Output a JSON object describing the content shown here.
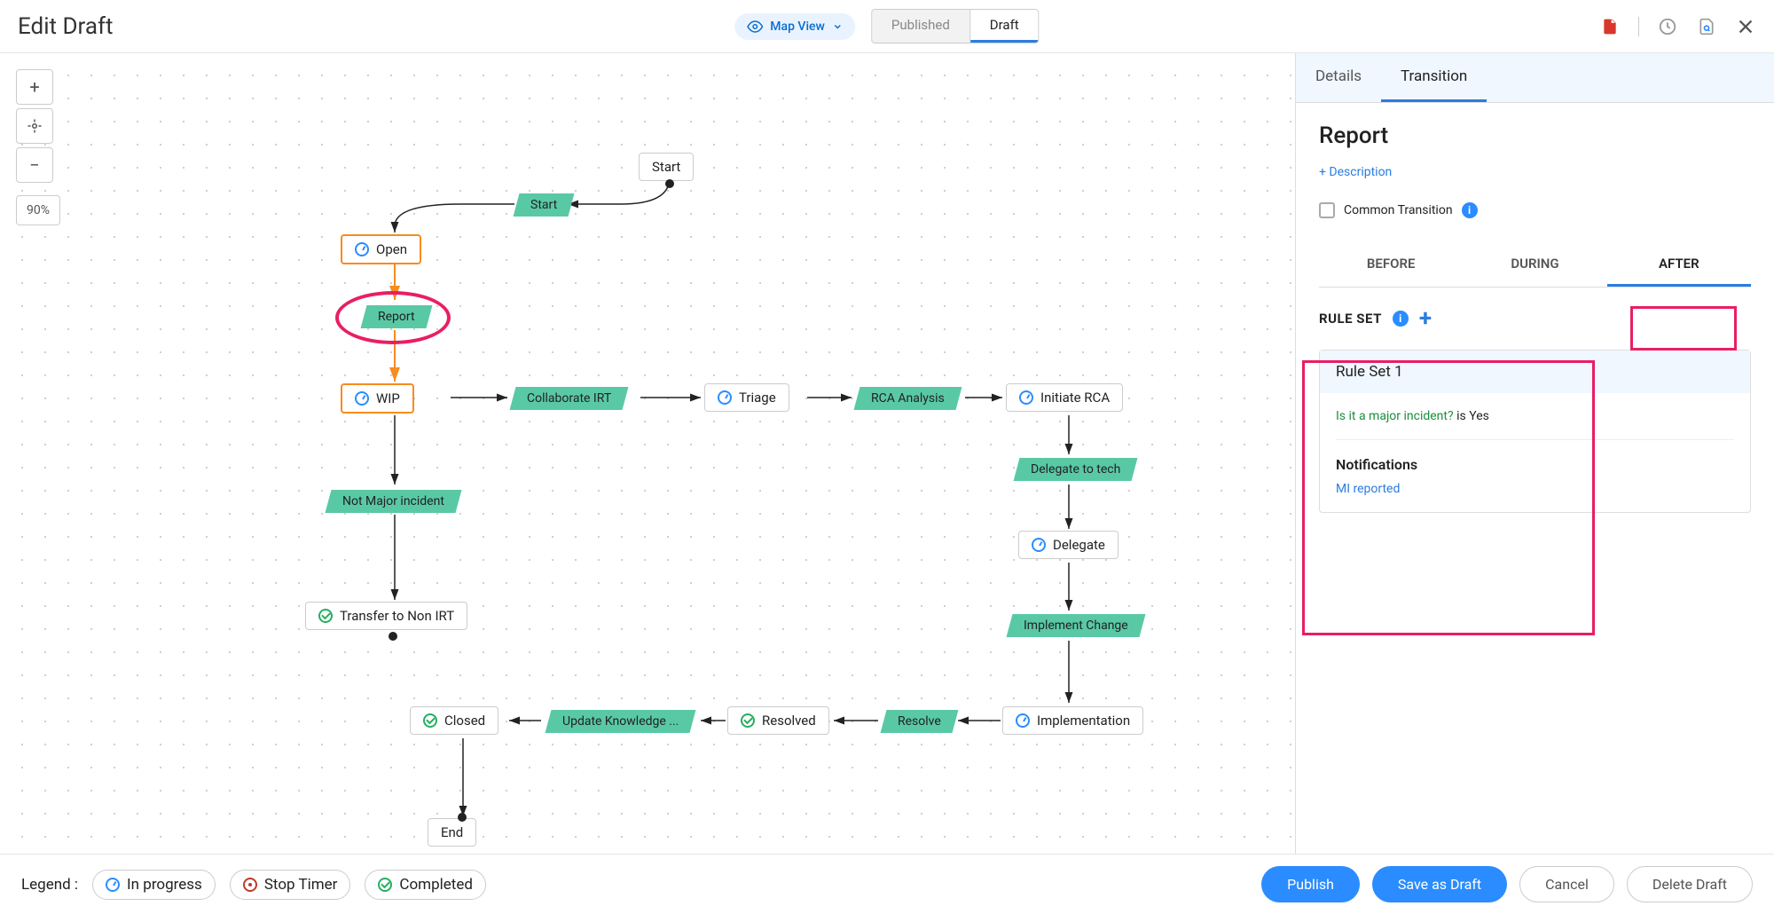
{
  "header": {
    "title": "Edit Draft",
    "map_view": "Map View",
    "seg_published": "Published",
    "seg_draft": "Draft"
  },
  "zoom": {
    "pct": "90%"
  },
  "nodes": {
    "start": "Start",
    "open": "Open",
    "wip": "WIP",
    "triage": "Triage",
    "initiate_rca": "Initiate RCA",
    "delegate": "Delegate",
    "transfer": "Transfer to Non IRT",
    "closed": "Closed",
    "resolved": "Resolved",
    "implementation": "Implementation",
    "end": "End"
  },
  "trans": {
    "start": "Start",
    "report": "Report",
    "collab": "Collaborate IRT",
    "rca": "RCA Analysis",
    "delegate_tech": "Delegate to tech",
    "not_major": "Not Major incident",
    "impl_change": "Implement Change",
    "update_k": "Update Knowledge ...",
    "resolve": "Resolve"
  },
  "panel": {
    "tab_details": "Details",
    "tab_transition": "Transition",
    "title": "Report",
    "add_desc": "+ Description",
    "common": "Common Transition",
    "sub_before": "BEFORE",
    "sub_during": "DURING",
    "sub_after": "AFTER",
    "ruleset_label": "RULE SET",
    "rs1_title": "Rule Set 1",
    "cond_q": "Is it a major incident?",
    "cond_is": "is",
    "cond_v": "Yes",
    "notif_label": "Notifications",
    "notif_item": "MI reported"
  },
  "legend": {
    "label": "Legend  :",
    "in_progress": "In progress",
    "stop_timer": "Stop Timer",
    "completed": "Completed"
  },
  "actions": {
    "publish": "Publish",
    "save": "Save as Draft",
    "cancel": "Cancel",
    "delete": "Delete Draft"
  }
}
